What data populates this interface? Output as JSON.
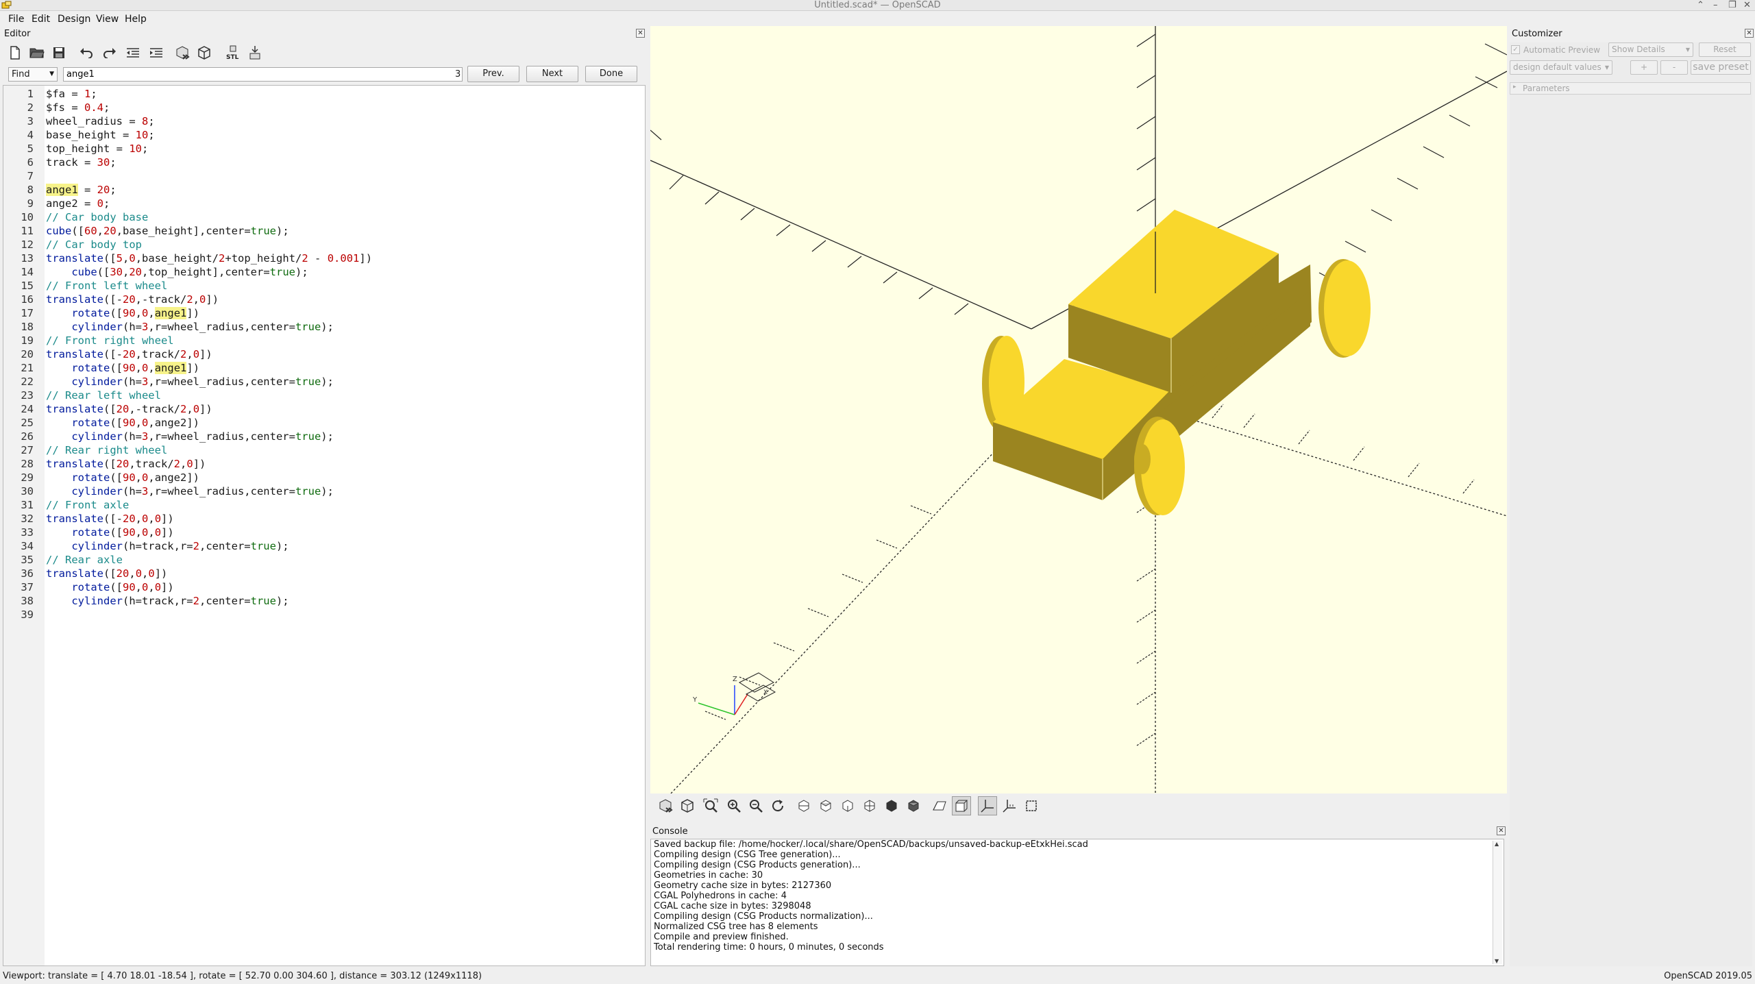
{
  "window": {
    "title": "Untitled.scad* — OpenSCAD",
    "controls": [
      "⌃",
      "–",
      "❐",
      "✕"
    ]
  },
  "menu": [
    "File",
    "Edit",
    "Design",
    "View",
    "Help"
  ],
  "editor": {
    "title": "Editor",
    "toolbar_icons": [
      "new-file-icon",
      "open-file-icon",
      "save-icon",
      "undo-icon",
      "redo-icon",
      "unindent-icon",
      "indent-icon",
      "preview-icon",
      "render-icon",
      "export-stl-icon",
      "send-to-print-icon"
    ],
    "find": {
      "mode": "Find",
      "query": "ange1",
      "count": "3",
      "prev_label": "Prev.",
      "next_label": "Next",
      "done_label": "Done"
    },
    "lines": [
      "$fa = 1;",
      "$fs = 0.4;",
      "wheel_radius = 8;",
      "base_height = 10;",
      "top_height = 10;",
      "track = 30;",
      "",
      "ange1 = 20;",
      "ange2 = 0;",
      "// Car body base",
      "cube([60,20,base_height],center=true);",
      "// Car body top",
      "translate([5,0,base_height/2+top_height/2 - 0.001])",
      "    cube([30,20,top_height],center=true);",
      "// Front left wheel",
      "translate([-20,-track/2,0])",
      "    rotate([90,0,ange1])",
      "    cylinder(h=3,r=wheel_radius,center=true);",
      "// Front right wheel",
      "translate([-20,track/2,0])",
      "    rotate([90,0,ange1])",
      "    cylinder(h=3,r=wheel_radius,center=true);",
      "// Rear left wheel",
      "translate([20,-track/2,0])",
      "    rotate([90,0,ange2])",
      "    cylinder(h=3,r=wheel_radius,center=true);",
      "// Rear right wheel",
      "translate([20,track/2,0])",
      "    rotate([90,0,ange2])",
      "    cylinder(h=3,r=wheel_radius,center=true);",
      "// Front axle",
      "translate([-20,0,0])",
      "    rotate([90,0,0])",
      "    cylinder(h=track,r=2,center=true);",
      "// Rear axle",
      "translate([20,0,0])",
      "    rotate([90,0,0])",
      "    cylinder(h=track,r=2,center=true);",
      ""
    ]
  },
  "viewport": {
    "axes_labels": {
      "x": "X",
      "y": "Y",
      "z": "Z"
    },
    "toolbar_icons": [
      "preview-icon",
      "render-icon",
      "view-all-icon",
      "zoom-in-icon",
      "zoom-out-icon",
      "reset-view-icon",
      "view-right-icon",
      "view-top-icon",
      "view-bottom-icon",
      "view-left-icon",
      "view-front-icon",
      "view-back-icon",
      "perspective-icon",
      "orthogonal-icon",
      "show-axes-icon",
      "show-scale-icon",
      "show-edges-icon"
    ],
    "colors": {
      "background": "#ffffe5",
      "model_light": "#f9d72c",
      "model_dark": "#9b8520",
      "model_mid": "#c9ac23"
    }
  },
  "console": {
    "title": "Console",
    "lines": [
      "Saved backup file: /home/hocker/.local/share/OpenSCAD/backups/unsaved-backup-eEtxkHei.scad",
      "Compiling design (CSG Tree generation)...",
      "Compiling design (CSG Products generation)...",
      "Geometries in cache: 30",
      "Geometry cache size in bytes: 2127360",
      "CGAL Polyhedrons in cache: 4",
      "CGAL cache size in bytes: 3298048",
      "Compiling design (CSG Products normalization)...",
      "Normalized CSG tree has 8 elements",
      "Compile and preview finished.",
      "Total rendering time: 0 hours, 0 minutes, 0 seconds"
    ]
  },
  "customizer": {
    "title": "Customizer",
    "auto_preview": "Automatic Preview",
    "show_details": "Show Details",
    "reset": "Reset",
    "preset": "design default values",
    "plus": "+",
    "minus": "-",
    "save_preset": "save preset",
    "parameters": "Parameters"
  },
  "status": {
    "viewport": "Viewport: translate = [ 4.70 18.01 -18.54 ], rotate = [ 52.70 0.00 304.60 ], distance = 303.12 (1249x1118)",
    "version": "OpenSCAD 2019.05"
  }
}
